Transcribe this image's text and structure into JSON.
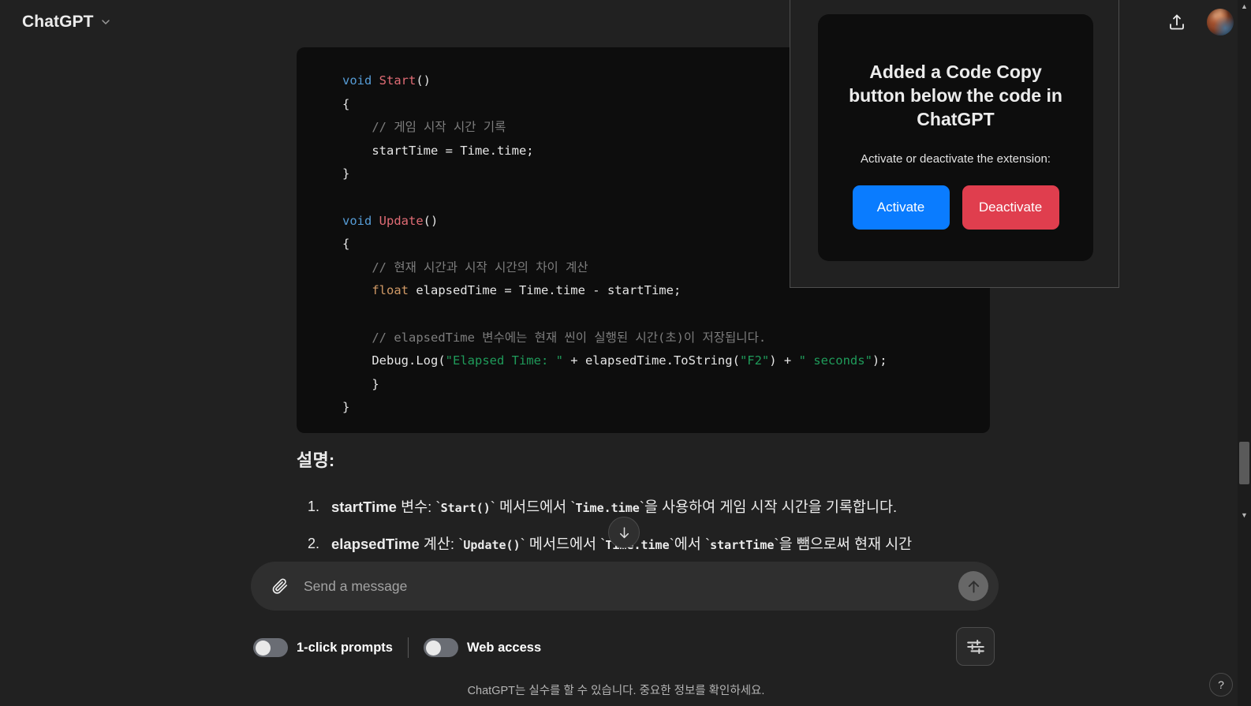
{
  "header": {
    "brand": "ChatGPT",
    "chevron_icon": "chevron-down-icon",
    "share_icon": "share-upload-icon",
    "avatar_icon": "user-avatar"
  },
  "code_block": {
    "language": "csharp",
    "lines": [
      [
        {
          "t": "void ",
          "c": "kw"
        },
        {
          "t": "Start",
          "c": "type"
        },
        {
          "t": "()",
          "c": "pl"
        }
      ],
      [
        {
          "t": "{",
          "c": "pl"
        }
      ],
      [
        {
          "t": "    // 게임 시작 시간 기록",
          "c": "cm"
        }
      ],
      [
        {
          "t": "    startTime = Time.time;",
          "c": "pl"
        }
      ],
      [
        {
          "t": "}",
          "c": "pl"
        }
      ],
      [],
      [
        {
          "t": "void ",
          "c": "kw"
        },
        {
          "t": "Update",
          "c": "type"
        },
        {
          "t": "()",
          "c": "pl"
        }
      ],
      [
        {
          "t": "{",
          "c": "pl"
        }
      ],
      [
        {
          "t": "    // 현재 시간과 시작 시간의 차이 계산",
          "c": "cm"
        }
      ],
      [
        {
          "t": "    ",
          "c": "pl"
        },
        {
          "t": "float",
          "c": "fl"
        },
        {
          "t": " elapsedTime = Time.time - startTime;",
          "c": "pl"
        }
      ],
      [],
      [
        {
          "t": "    // elapsedTime 변수에는 현재 씬이 실행된 시간(초)이 저장됩니다.",
          "c": "cm"
        }
      ],
      [
        {
          "t": "    Debug.Log(",
          "c": "pl"
        },
        {
          "t": "\"Elapsed Time: \"",
          "c": "str"
        },
        {
          "t": " + elapsedTime.ToString(",
          "c": "pl"
        },
        {
          "t": "\"F2\"",
          "c": "str"
        },
        {
          "t": ") + ",
          "c": "pl"
        },
        {
          "t": "\" seconds\"",
          "c": "str"
        },
        {
          "t": ");",
          "c": "pl"
        }
      ],
      [
        {
          "t": "    }",
          "c": "pl"
        }
      ],
      [
        {
          "t": "}",
          "c": "pl"
        }
      ]
    ]
  },
  "explanation": {
    "heading": "설명:",
    "items": [
      {
        "index": "1.",
        "bold": "startTime",
        "rest_1": " 변수: `",
        "code_1": "Start()",
        "rest_2": "` 메서드에서 `",
        "code_2": "Time.time",
        "rest_3": "`을 사용하여 게임 시작 시간을 기록합니다."
      },
      {
        "index": "2.",
        "bold": "elapsedTime",
        "rest_1": " 계산: `",
        "code_1": "Update()",
        "rest_2": "` 메서드에서 `",
        "code_2": "Time.time",
        "rest_3": "`에서 `",
        "code_3": "startTime",
        "rest_4": "`을 뺌으로써 현재 시간"
      }
    ]
  },
  "scroll_to_bottom": {
    "icon": "arrow-down-icon"
  },
  "composer": {
    "attach_icon": "paperclip-icon",
    "placeholder": "Send a message",
    "value": "",
    "send_icon": "arrow-up-icon"
  },
  "toggles": [
    {
      "label": "1-click prompts",
      "on": false
    },
    {
      "label": "Web access",
      "on": false
    }
  ],
  "settings_button": {
    "icon": "sliders-icon"
  },
  "footnote": "ChatGPT는 실수를 할 수 있습니다. 중요한 정보를 확인하세요.",
  "extension_popup": {
    "title": "Added a Code Copy button below the code in ChatGPT",
    "subtitle": "Activate or deactivate the extension:",
    "activate_label": "Activate",
    "deactivate_label": "Deactivate",
    "activate_color": "#0a7cff",
    "deactivate_color": "#e03e4e"
  },
  "help_button": {
    "label": "?"
  },
  "scrollbar": {
    "up_arrow": "▲",
    "down_arrow": "▼"
  },
  "colors": {
    "page_bg": "#212121",
    "code_bg": "#0d0d0d",
    "composer_bg": "#2f2f2f",
    "accent_blue": "#0a7cff",
    "accent_red": "#e03e4e"
  }
}
